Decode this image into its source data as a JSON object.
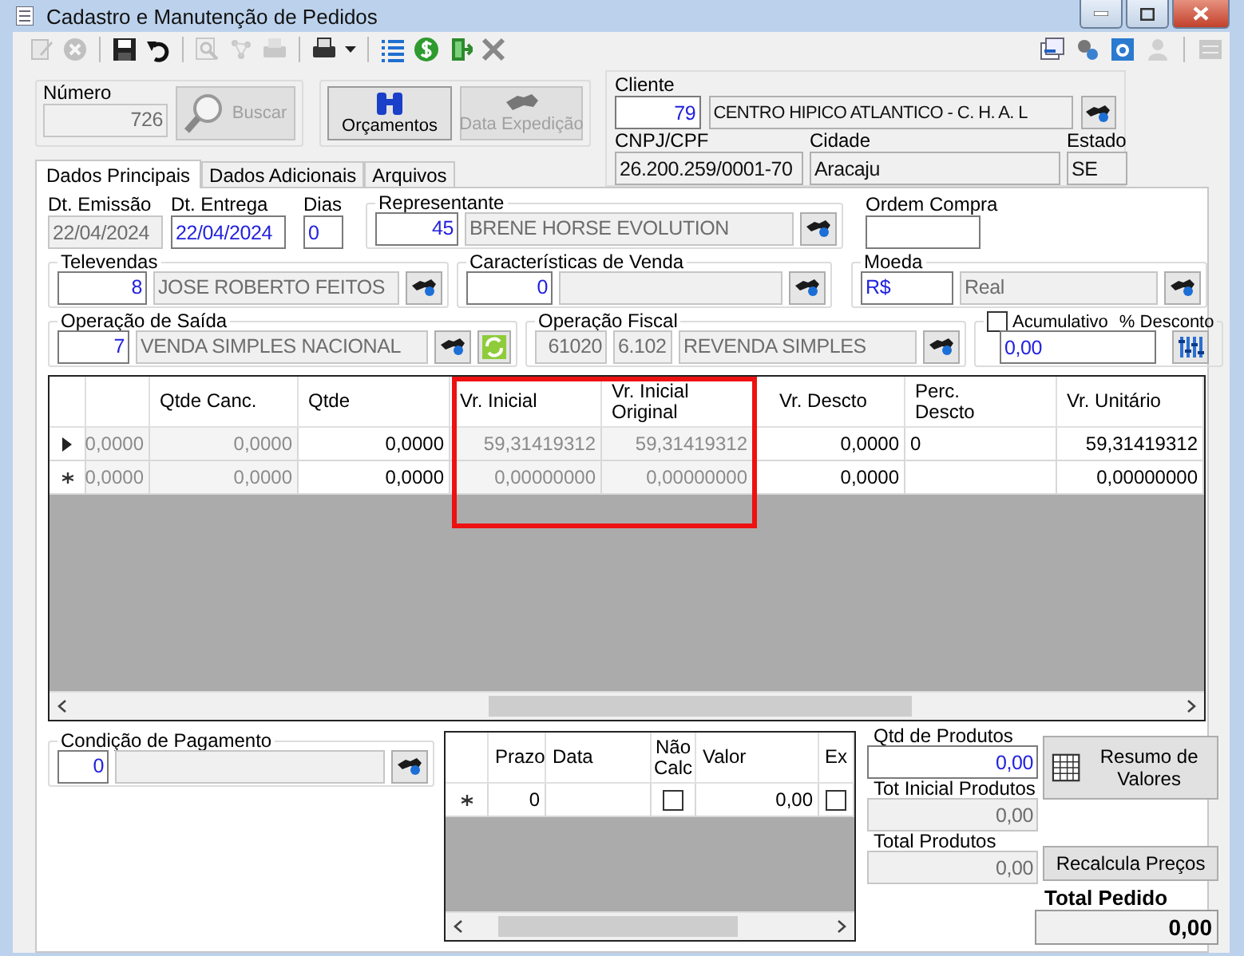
{
  "window": {
    "title": "Cadastro e Manutenção de Pedidos"
  },
  "toolbar": [
    {
      "kind": "edit",
      "disabled": true
    },
    {
      "kind": "cancel",
      "disabled": true
    },
    {
      "kind": "separator"
    },
    {
      "kind": "save",
      "disabled": false
    },
    {
      "kind": "undo",
      "disabled": false
    },
    {
      "kind": "separator"
    },
    {
      "kind": "zoom",
      "disabled": true
    },
    {
      "kind": "network",
      "disabled": true
    },
    {
      "kind": "print",
      "disabled": true
    },
    {
      "kind": "separator"
    },
    {
      "kind": "print_menu",
      "disabled": false
    },
    {
      "kind": "separator"
    },
    {
      "kind": "list",
      "disabled": false
    },
    {
      "kind": "coin",
      "disabled": false
    },
    {
      "kind": "exit",
      "disabled": false
    },
    {
      "kind": "close",
      "disabled": false
    }
  ],
  "toolbar_right": [
    {
      "kind": "window",
      "disabled": false
    },
    {
      "kind": "gears",
      "disabled": false
    },
    {
      "kind": "app",
      "disabled": false
    },
    {
      "kind": "person",
      "disabled": true
    },
    {
      "kind": "separator"
    },
    {
      "kind": "panel",
      "disabled": true
    }
  ],
  "numero": {
    "label": "Número",
    "value": "726",
    "kind": "readonly"
  },
  "top_buttons": [
    {
      "kind": "search",
      "label": "Buscar",
      "disabled": true
    },
    {
      "kind": "budget",
      "label": "Orçamentos",
      "disabled": false
    },
    {
      "kind": "shipping",
      "label": "Data Expedição",
      "disabled": true
    }
  ],
  "cliente": {
    "label": "Cliente",
    "code": {
      "value": "79",
      "kind": "editable"
    },
    "name": {
      "value": "CENTRO HIPICO ATLANTICO - C. H. A. L",
      "kind": "display"
    },
    "cnpj": {
      "label": "CNPJ/CPF",
      "value": "26.200.259/0001-70",
      "kind": "display"
    },
    "cidade": {
      "label": "Cidade",
      "value": "Aracaju",
      "kind": "display"
    },
    "estado": {
      "label": "Estado",
      "value": "SE",
      "kind": "display"
    }
  },
  "tabs": [
    {
      "label": "Dados Principais",
      "selected": true
    },
    {
      "label": "Dados Adicionais",
      "selected": false
    },
    {
      "label": "Arquivos",
      "selected": false
    }
  ],
  "dt_emissao": {
    "label": "Dt. Emissão",
    "value": "22/04/2024",
    "kind": "readonly"
  },
  "dt_entrega": {
    "label": "Dt. Entrega",
    "value": "22/04/2024",
    "kind": "editable"
  },
  "dias": {
    "label": "Dias",
    "value": "0",
    "kind": "editable"
  },
  "representante": {
    "label": "Representante",
    "code": {
      "value": "45",
      "kind": "editable"
    },
    "name": {
      "value": "BRENE HORSE EVOLUTION",
      "kind": "readonly"
    }
  },
  "ordem_compra": {
    "label": "Ordem Compra",
    "kind": "editable"
  },
  "televendas": {
    "label": "Televendas",
    "code": {
      "value": "8",
      "kind": "editable"
    },
    "name": {
      "value": "JOSE ROBERTO FEITOS",
      "kind": "readonly"
    }
  },
  "caracteristicas": {
    "label": "Características de Venda",
    "code": {
      "value": "0",
      "kind": "editable"
    },
    "name": {
      "kind": "readonly"
    }
  },
  "moeda": {
    "label": "Moeda",
    "code": {
      "value": "R$",
      "kind": "editable"
    },
    "name": {
      "value": "Real",
      "kind": "readonly"
    }
  },
  "operacao_saida": {
    "label": "Operação de Saída",
    "code": {
      "value": "7",
      "kind": "editable"
    },
    "name": {
      "value": "VENDA SIMPLES NACIONAL",
      "kind": "readonly"
    }
  },
  "operacao_fiscal": {
    "label": "Operação Fiscal",
    "code": {
      "value": "61020",
      "kind": "readonly"
    },
    "cfop": {
      "value": "6.102",
      "kind": "readonly"
    },
    "name": {
      "value": "REVENDA SIMPLES",
      "kind": "readonly"
    }
  },
  "desconto": {
    "acumulativo": {
      "label": "Acumulativo",
      "checked": false
    },
    "label": "% Desconto",
    "field": {
      "value": "0,00",
      "kind": "editable"
    }
  },
  "items_table": {
    "columns": [
      {
        "readonly": true
      },
      {
        "label": "Qtde Canc.",
        "readonly": true
      },
      {
        "label": "Qtde",
        "readonly": false
      },
      {
        "label": "Vr. Inicial",
        "readonly": true
      },
      {
        "label": "Vr. Inicial Original",
        "readonly": true
      },
      {
        "label": "Vr. Descto",
        "readonly": false
      },
      {
        "label": "Perc. Descto",
        "readonly": false
      },
      {
        "label": "Vr. Unitário",
        "readonly": false
      }
    ],
    "rows": [
      {
        "kind": "current",
        "cells": [
          "0,0000",
          "0,0000",
          "0,0000",
          "59,31419312",
          "59,31419312",
          "0,0000",
          "0",
          "59,31419312"
        ]
      },
      {
        "kind": "new",
        "cells": [
          "0,0000",
          "0,0000",
          "0,0000",
          "0,00000000",
          "0,00000000",
          "0,0000",
          null,
          "0,00000000"
        ]
      }
    ]
  },
  "condicao_pagamento": {
    "label": "Condição de Pagamento",
    "code": {
      "value": "0",
      "kind": "editable"
    },
    "name": {
      "kind": "readonly"
    }
  },
  "payment_table": {
    "columns": [
      {
        "label": "Prazo",
        "kind": "number"
      },
      {
        "label": "Data",
        "kind": "text"
      },
      {
        "label": "Não Calc",
        "kind": "check"
      },
      {
        "label": "Valor",
        "kind": "number"
      },
      {
        "label": "Ex",
        "kind": "check"
      }
    ],
    "rows": [
      {
        "kind": "new",
        "cells": [
          "0",
          null,
          false,
          "0,00",
          false
        ]
      }
    ]
  },
  "totals": [
    {
      "label": "Qtd de Produtos",
      "value": "0,00",
      "kind": "editable"
    },
    {
      "label": "Tot Inicial Produtos",
      "value": "0,00",
      "kind": "readonly"
    },
    {
      "label": "Total Produtos",
      "value": "0,00",
      "kind": "readonly"
    }
  ],
  "resumo_button": {
    "label": "Resumo de Valores"
  },
  "recalcula_button": {
    "label": "Recalcula Preços"
  },
  "total_pedido": {
    "label": "Total Pedido",
    "value": "0,00"
  }
}
